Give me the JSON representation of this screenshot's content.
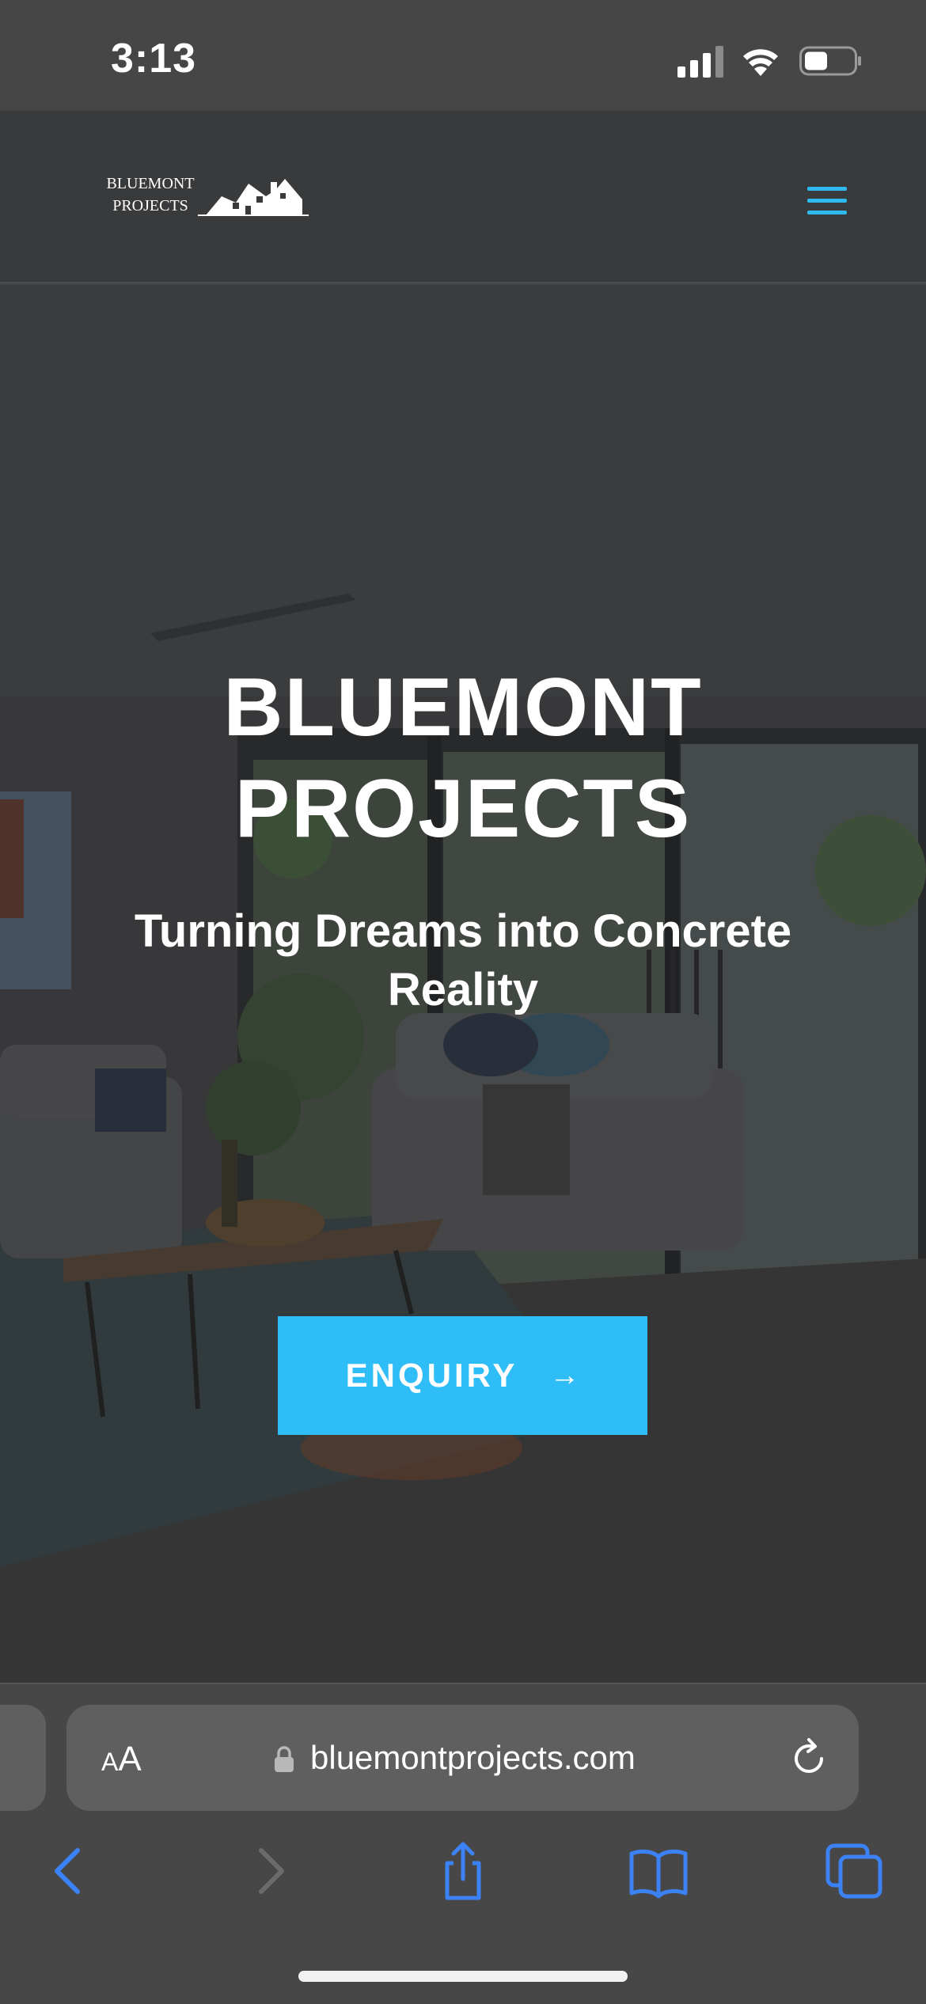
{
  "status_bar": {
    "time": "3:13"
  },
  "site": {
    "logo_line1": "BLUEMONT",
    "logo_line2": "PROJECTS"
  },
  "hero": {
    "title_line1": "BLUEMONT",
    "title_line2": "PROJECTS",
    "subtitle": "Turning Dreams into Concrete Reality",
    "cta_label": "ENQUIRY",
    "cta_arrow": "→"
  },
  "browser": {
    "text_size_label_small": "A",
    "text_size_label_large": "A",
    "url": "bluemontprojects.com"
  },
  "colors": {
    "accent": "#2ebdf6",
    "ios_blue": "#3b82f6"
  },
  "icons": {
    "menu": "hamburger-icon",
    "lock": "lock-icon",
    "reload": "reload-icon",
    "back": "chevron-left-icon",
    "forward": "chevron-right-icon",
    "share": "share-icon",
    "bookmarks": "book-icon",
    "tabs": "tabs-icon"
  }
}
